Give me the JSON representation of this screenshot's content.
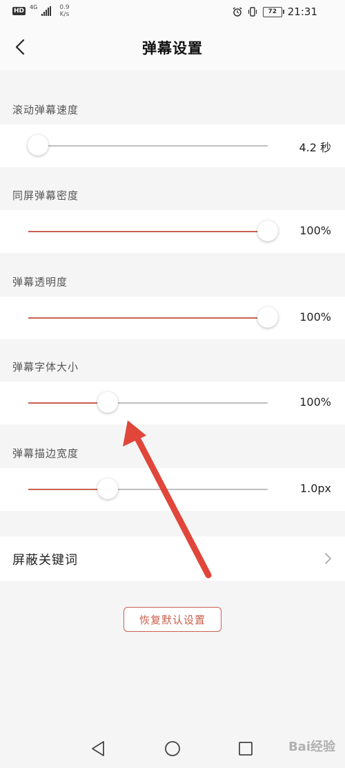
{
  "status_bar": {
    "hd": "HD",
    "network": "4G",
    "speed_value": "0.9",
    "speed_unit": "K/s",
    "battery": "72",
    "time": "21:31"
  },
  "header": {
    "title": "弹幕设置"
  },
  "sliders": [
    {
      "label": "滚动弹幕速度",
      "value_text": "4.2 秒",
      "fraction": 0.04
    },
    {
      "label": "同屏弹幕密度",
      "value_text": "100%",
      "fraction": 1.0
    },
    {
      "label": "弹幕透明度",
      "value_text": "100%",
      "fraction": 1.0
    },
    {
      "label": "弹幕字体大小",
      "value_text": "100%",
      "fraction": 0.33
    },
    {
      "label": "弹幕描边宽度",
      "value_text": "1.0px",
      "fraction": 0.33
    }
  ],
  "keyword_row": {
    "label": "屏蔽关键词"
  },
  "reset_button": {
    "label": "恢复默认设置"
  },
  "colors": {
    "accent": "#c9604e",
    "annotation": "#e0463a"
  },
  "watermark": "Bai经验"
}
